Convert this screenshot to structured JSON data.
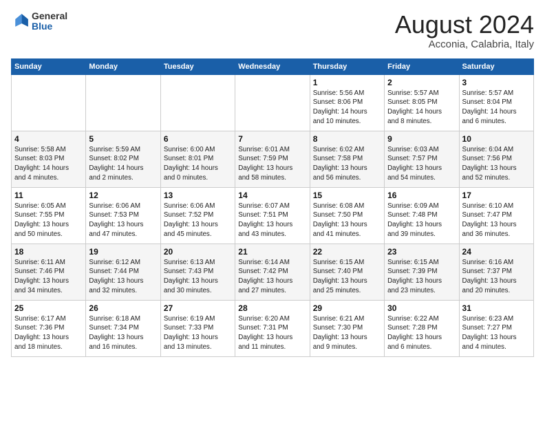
{
  "header": {
    "logo_general": "General",
    "logo_blue": "Blue",
    "month_title": "August 2024",
    "subtitle": "Acconia, Calabria, Italy"
  },
  "days_of_week": [
    "Sunday",
    "Monday",
    "Tuesday",
    "Wednesday",
    "Thursday",
    "Friday",
    "Saturday"
  ],
  "weeks": [
    [
      {
        "day": "",
        "info": ""
      },
      {
        "day": "",
        "info": ""
      },
      {
        "day": "",
        "info": ""
      },
      {
        "day": "",
        "info": ""
      },
      {
        "day": "1",
        "info": "Sunrise: 5:56 AM\nSunset: 8:06 PM\nDaylight: 14 hours\nand 10 minutes."
      },
      {
        "day": "2",
        "info": "Sunrise: 5:57 AM\nSunset: 8:05 PM\nDaylight: 14 hours\nand 8 minutes."
      },
      {
        "day": "3",
        "info": "Sunrise: 5:57 AM\nSunset: 8:04 PM\nDaylight: 14 hours\nand 6 minutes."
      }
    ],
    [
      {
        "day": "4",
        "info": "Sunrise: 5:58 AM\nSunset: 8:03 PM\nDaylight: 14 hours\nand 4 minutes."
      },
      {
        "day": "5",
        "info": "Sunrise: 5:59 AM\nSunset: 8:02 PM\nDaylight: 14 hours\nand 2 minutes."
      },
      {
        "day": "6",
        "info": "Sunrise: 6:00 AM\nSunset: 8:01 PM\nDaylight: 14 hours\nand 0 minutes."
      },
      {
        "day": "7",
        "info": "Sunrise: 6:01 AM\nSunset: 7:59 PM\nDaylight: 13 hours\nand 58 minutes."
      },
      {
        "day": "8",
        "info": "Sunrise: 6:02 AM\nSunset: 7:58 PM\nDaylight: 13 hours\nand 56 minutes."
      },
      {
        "day": "9",
        "info": "Sunrise: 6:03 AM\nSunset: 7:57 PM\nDaylight: 13 hours\nand 54 minutes."
      },
      {
        "day": "10",
        "info": "Sunrise: 6:04 AM\nSunset: 7:56 PM\nDaylight: 13 hours\nand 52 minutes."
      }
    ],
    [
      {
        "day": "11",
        "info": "Sunrise: 6:05 AM\nSunset: 7:55 PM\nDaylight: 13 hours\nand 50 minutes."
      },
      {
        "day": "12",
        "info": "Sunrise: 6:06 AM\nSunset: 7:53 PM\nDaylight: 13 hours\nand 47 minutes."
      },
      {
        "day": "13",
        "info": "Sunrise: 6:06 AM\nSunset: 7:52 PM\nDaylight: 13 hours\nand 45 minutes."
      },
      {
        "day": "14",
        "info": "Sunrise: 6:07 AM\nSunset: 7:51 PM\nDaylight: 13 hours\nand 43 minutes."
      },
      {
        "day": "15",
        "info": "Sunrise: 6:08 AM\nSunset: 7:50 PM\nDaylight: 13 hours\nand 41 minutes."
      },
      {
        "day": "16",
        "info": "Sunrise: 6:09 AM\nSunset: 7:48 PM\nDaylight: 13 hours\nand 39 minutes."
      },
      {
        "day": "17",
        "info": "Sunrise: 6:10 AM\nSunset: 7:47 PM\nDaylight: 13 hours\nand 36 minutes."
      }
    ],
    [
      {
        "day": "18",
        "info": "Sunrise: 6:11 AM\nSunset: 7:46 PM\nDaylight: 13 hours\nand 34 minutes."
      },
      {
        "day": "19",
        "info": "Sunrise: 6:12 AM\nSunset: 7:44 PM\nDaylight: 13 hours\nand 32 minutes."
      },
      {
        "day": "20",
        "info": "Sunrise: 6:13 AM\nSunset: 7:43 PM\nDaylight: 13 hours\nand 30 minutes."
      },
      {
        "day": "21",
        "info": "Sunrise: 6:14 AM\nSunset: 7:42 PM\nDaylight: 13 hours\nand 27 minutes."
      },
      {
        "day": "22",
        "info": "Sunrise: 6:15 AM\nSunset: 7:40 PM\nDaylight: 13 hours\nand 25 minutes."
      },
      {
        "day": "23",
        "info": "Sunrise: 6:15 AM\nSunset: 7:39 PM\nDaylight: 13 hours\nand 23 minutes."
      },
      {
        "day": "24",
        "info": "Sunrise: 6:16 AM\nSunset: 7:37 PM\nDaylight: 13 hours\nand 20 minutes."
      }
    ],
    [
      {
        "day": "25",
        "info": "Sunrise: 6:17 AM\nSunset: 7:36 PM\nDaylight: 13 hours\nand 18 minutes."
      },
      {
        "day": "26",
        "info": "Sunrise: 6:18 AM\nSunset: 7:34 PM\nDaylight: 13 hours\nand 16 minutes."
      },
      {
        "day": "27",
        "info": "Sunrise: 6:19 AM\nSunset: 7:33 PM\nDaylight: 13 hours\nand 13 minutes."
      },
      {
        "day": "28",
        "info": "Sunrise: 6:20 AM\nSunset: 7:31 PM\nDaylight: 13 hours\nand 11 minutes."
      },
      {
        "day": "29",
        "info": "Sunrise: 6:21 AM\nSunset: 7:30 PM\nDaylight: 13 hours\nand 9 minutes."
      },
      {
        "day": "30",
        "info": "Sunrise: 6:22 AM\nSunset: 7:28 PM\nDaylight: 13 hours\nand 6 minutes."
      },
      {
        "day": "31",
        "info": "Sunrise: 6:23 AM\nSunset: 7:27 PM\nDaylight: 13 hours\nand 4 minutes."
      }
    ]
  ]
}
